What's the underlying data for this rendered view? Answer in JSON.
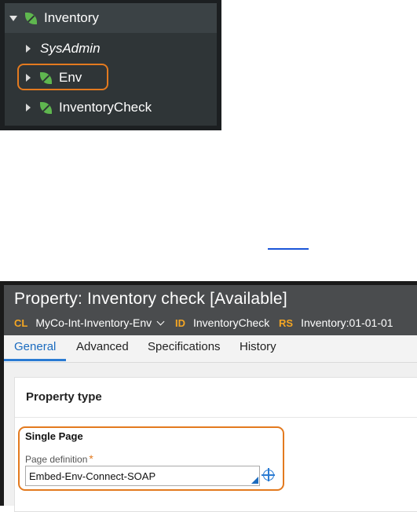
{
  "tree": {
    "root_label": "Inventory",
    "items": [
      {
        "label": "SysAdmin",
        "italic": true,
        "has_leaf_icon": false
      },
      {
        "label": "Env",
        "italic": false,
        "has_leaf_icon": true,
        "highlighted": true
      },
      {
        "label": "InventoryCheck",
        "italic": false,
        "has_leaf_icon": true
      }
    ]
  },
  "property": {
    "title": "Property: Inventory check [Available]",
    "meta": {
      "cl_key": "CL",
      "cl_value": "MyCo-Int-Inventory-Env",
      "id_key": "ID",
      "id_value": "InventoryCheck",
      "rs_key": "RS",
      "rs_value": "Inventory:01-01-01"
    },
    "tabs": [
      {
        "label": "General",
        "active": true
      },
      {
        "label": "Advanced",
        "active": false
      },
      {
        "label": "Specifications",
        "active": false
      },
      {
        "label": "History",
        "active": false
      }
    ],
    "section_title": "Property type",
    "single_page": {
      "title": "Single Page",
      "field_label": "Page definition",
      "required_mark": "*",
      "field_value": "Embed-Env-Connect-SOAP"
    }
  },
  "colors": {
    "highlight": "#e37a1f",
    "leaf": "#5fb74f",
    "meta_key": "#f5a623",
    "active_tab": "#1b6bbf",
    "link": "#1a55d8"
  },
  "icons": {
    "tree_expand": "chevron-down-icon",
    "tree_collapse": "chevron-right-icon",
    "leaf": "leaf-icon",
    "class_dropdown": "chevron-down-icon",
    "page_picker": "crosshair-icon"
  }
}
